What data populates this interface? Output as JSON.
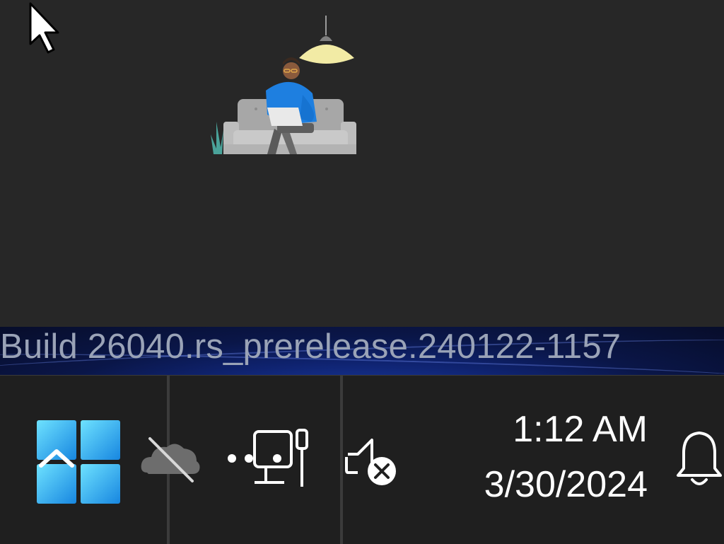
{
  "desktop": {
    "background_color": "#272727",
    "illustration": "person-on-couch-with-laptop"
  },
  "cursor": {
    "icon": "arrow-pointer-icon"
  },
  "watermark": {
    "text": "Build 26040.rs_prerelease.240122-1157"
  },
  "taskbar": {
    "background_color": "#1f1f1f",
    "start": {
      "icon": "windows-start-icon",
      "accent": "#3fc3f7"
    },
    "tray": {
      "chevron": {
        "icon": "chevron-up-icon"
      },
      "onedrive": {
        "icon": "onedrive-offline-icon"
      },
      "network": {
        "icon": "network-wired-icon"
      },
      "volume": {
        "icon": "speaker-muted-icon"
      }
    },
    "clock": {
      "time": "1:12 AM",
      "date": "3/30/2024"
    },
    "notifications": {
      "icon": "bell-icon"
    }
  }
}
